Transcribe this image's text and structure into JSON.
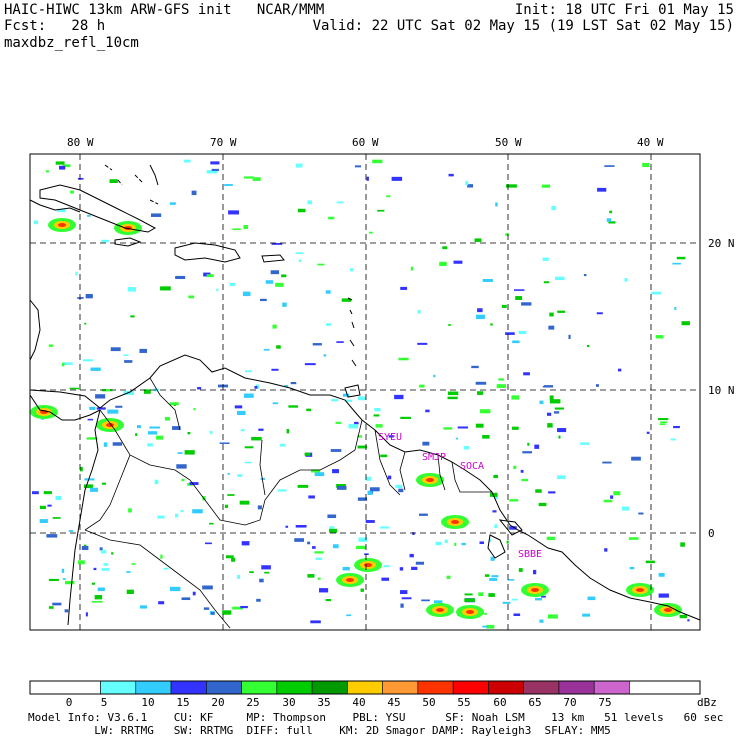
{
  "header": {
    "line1_left": "HAIC-HIWC 13km ARW-GFS init   NCAR/MMM",
    "line1_right": "Init: 18 UTC Fri 01 May 15",
    "line2_left": "Fcst:   28 h",
    "line2_right": "Valid: 22 UTC Sat 02 May 15 (19 LST Sat 02 May 15)",
    "line3_left": "maxdbz_refl_10cm"
  },
  "map": {
    "lon_labels": [
      "80 W",
      "70 W",
      "60 W",
      "50 W",
      "40 W"
    ],
    "lat_labels": [
      "20 N",
      "10 N",
      "0"
    ],
    "stations": [
      "SYEU",
      "SMJP",
      "SOCA",
      "SBBE"
    ]
  },
  "colorbar": {
    "unit": "dBz",
    "levels": [
      "0",
      "5",
      "10",
      "15",
      "20",
      "25",
      "30",
      "35",
      "40",
      "45",
      "50",
      "55",
      "60",
      "65",
      "70",
      "75"
    ],
    "colors": [
      "#ffffff",
      "#ffffff",
      "#66ffff",
      "#33ccff",
      "#3333ff",
      "#3366cc",
      "#33ff33",
      "#00cc00",
      "#009900",
      "#ffcc00",
      "#ff9933",
      "#ff3300",
      "#ff0000",
      "#cc0000",
      "#993366",
      "#993399",
      "#cc66cc"
    ]
  },
  "footer": {
    "line1": "Model Info: V3.6.1    CU: KF     MP: Thompson    PBL: YSU      SF: Noah LSM    13 km   51 levels   60 sec",
    "line2": "          LW: RRTMG   SW: RRTMG  DIFF: full    KM: 2D Smagor DAMP: Rayleigh3  SFLAY: MM5"
  }
}
